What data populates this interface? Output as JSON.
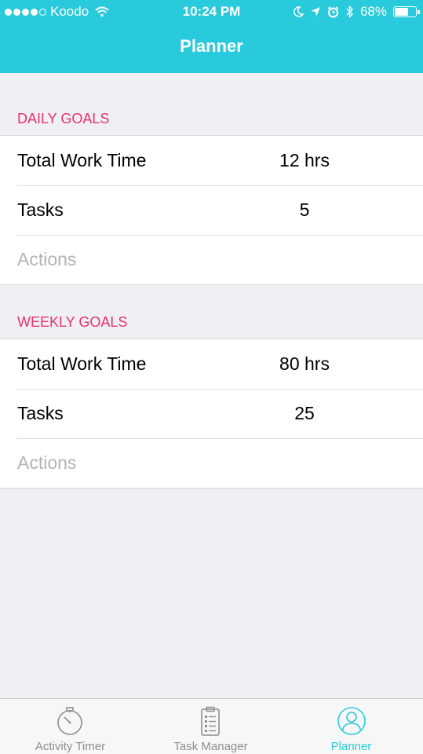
{
  "status_bar": {
    "carrier": "Koodo",
    "time": "10:24 PM",
    "battery_percent": "68%",
    "battery_level": 0.68,
    "signal_dots_filled": 4,
    "signal_dots_total": 5
  },
  "nav": {
    "title": "Planner"
  },
  "daily": {
    "header": "DAILY GOALS",
    "rows": [
      {
        "label": "Total Work Time",
        "value": "12 hrs"
      },
      {
        "label": "Tasks",
        "value": "5"
      },
      {
        "label": "Actions",
        "value": ""
      }
    ]
  },
  "weekly": {
    "header": "WEEKLY GOALS",
    "rows": [
      {
        "label": "Total Work Time",
        "value": "80 hrs"
      },
      {
        "label": "Tasks",
        "value": "25"
      },
      {
        "label": "Actions",
        "value": ""
      }
    ]
  },
  "tabbar": {
    "tabs": [
      {
        "label": "Activity Timer",
        "icon": "stopwatch-icon",
        "active": false
      },
      {
        "label": "Task Manager",
        "icon": "clipboard-icon",
        "active": false
      },
      {
        "label": "Planner",
        "icon": "person-icon",
        "active": true
      }
    ]
  },
  "colors": {
    "accent": "#29cadb",
    "section_header": "#e6336e",
    "background": "#efeff4",
    "muted_text": "#b3b3b8",
    "tab_inactive": "#8e8e93"
  }
}
